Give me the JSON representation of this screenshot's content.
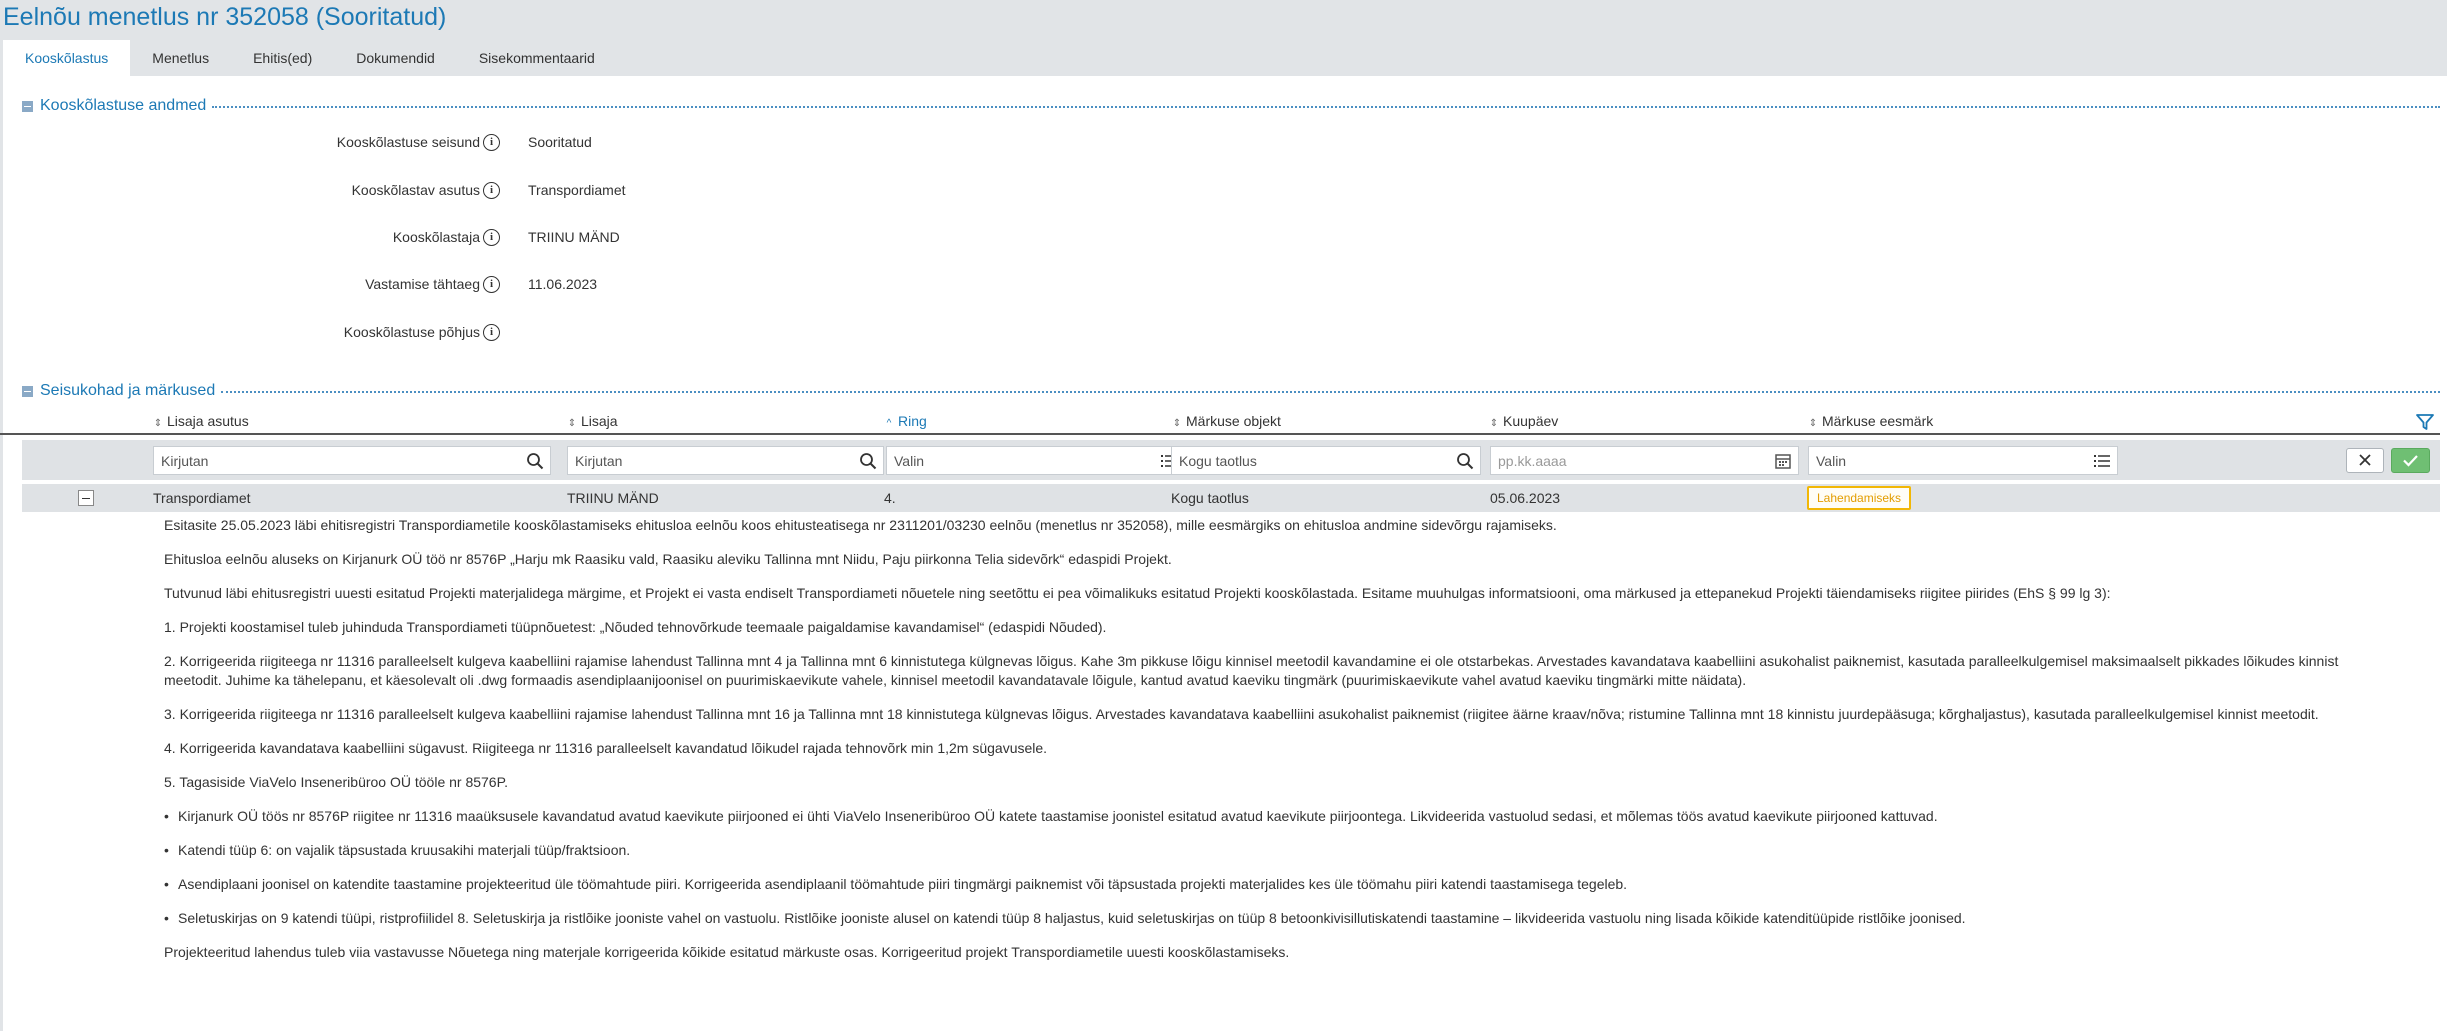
{
  "page": {
    "title": "Eelnõu menetlus nr 352058 (Sooritatud)"
  },
  "tabs": [
    {
      "label": "Kooskõlastus",
      "active": true
    },
    {
      "label": "Menetlus"
    },
    {
      "label": "Ehitis(ed)"
    },
    {
      "label": "Dokumendid"
    },
    {
      "label": "Sisekommentaarid"
    }
  ],
  "section_data": {
    "title": "Kooskõlastuse andmed",
    "fields": [
      {
        "label": "Kooskõlastuse seisund",
        "value": "Sooritatud"
      },
      {
        "label": "Kooskõlastav asutus",
        "value": "Transpordiamet"
      },
      {
        "label": "Kooskõlastaja",
        "value": "TRIINU MÄND"
      },
      {
        "label": "Vastamise tähtaeg",
        "value": "11.06.2023"
      },
      {
        "label": "Kooskõlastuse põhjus",
        "value": ""
      }
    ]
  },
  "section_remarks": {
    "title": "Seisukohad ja märkused",
    "columns": [
      "Lisaja asutus",
      "Lisaja",
      "Ring",
      "Märkuse objekt",
      "Kuupäev",
      "Märkuse eesmärk"
    ],
    "sorted_column": "Ring",
    "filters": {
      "lisaja_asutus": "Kirjutan",
      "lisaja": "Kirjutan",
      "ring": "Valin",
      "markuse_objekt": "Kogu taotlus",
      "kuupaev": "pp.kk.aaaa",
      "markuse_eesmark": "Valin"
    },
    "row": {
      "lisaja_asutus": "Transpordiamet",
      "lisaja": "TRIINU MÄND",
      "ring": "4.",
      "markuse_objekt": "Kogu taotlus",
      "kuupaev": "05.06.2023",
      "markuse_eesmark": "Lahendamiseks"
    },
    "comment": [
      {
        "text": "Esitasite 25.05.2023 läbi ehitisregistri Transpordiametile kooskõlastamiseks ehitusloa eelnõu koos ehitusteatisega nr 2311201/03230 eelnõu (menetlus nr 352058), mille eesmärgiks on ehitusloa andmine sidevõrgu rajamiseks."
      },
      {
        "text": "Ehitusloa eelnõu aluseks on Kirjanurk OÜ töö nr 8576P „Harju mk Raasiku vald, Raasiku aleviku Tallinna mnt Niidu, Paju piirkonna Telia sidevõrk“ edaspidi Projekt."
      },
      {
        "text": "Tutvunud läbi ehitusregistri uuesti esitatud Projekti materjalidega märgime, et Projekt ei vasta endiselt Transpordiameti nõuetele ning seetõttu ei pea võimalikuks esitatud Projekti kooskõlastada. Esitame muuhulgas informatsiooni, oma märkused ja ettepanekud Projekti täiendamiseks riigitee piirides (EhS § 99 lg 3):"
      },
      {
        "text": "1. Projekti koostamisel tuleb juhinduda Transpordiameti tüüpnõuetest: „Nõuded tehnovõrkude teemaale paigaldamise kavandamisel“ (edaspidi Nõuded)."
      },
      {
        "text": "2. Korrigeerida riigiteega nr 11316 paralleelselt kulgeva kaabelliini rajamise lahendust Tallinna mnt 4 ja Tallinna mnt 6 kinnistutega külgnevas lõigus. Kahe 3m pikkuse lõigu kinnisel meetodil kavandamine ei ole otstarbekas. Arvestades kavandatava kaabelliini asukohalist paiknemist, kasutada paralleelkulgemisel maksimaalselt pikkades lõikudes kinnist meetodit. Juhime ka tähelepanu, et käesolevalt oli .dwg formaadis asendiplaanijoonisel on puurimiskaevikute vahele, kinnisel meetodil kavandatavale lõigule, kantud avatud kaeviku tingmärk (puurimiskaevikute vahel avatud kaeviku tingmärki mitte näidata)."
      },
      {
        "text": "3. Korrigeerida riigiteega nr 11316 paralleelselt kulgeva kaabelliini rajamise lahendust Tallinna mnt 16 ja Tallinna mnt 18 kinnistutega külgnevas lõigus. Arvestades kavandatava kaabelliini asukohalist paiknemist (riigitee äärne kraav/nõva; ristumine Tallinna mnt 18 kinnistu juurdepääsuga; kõrghaljastus), kasutada paralleelkulgemisel kinnist meetodit."
      },
      {
        "text": "4. Korrigeerida kavandatava kaabelliini sügavust. Riigiteega nr 11316 paralleelselt kavandatud lõikudel rajada tehnovõrk min 1,2m sügavusele."
      },
      {
        "text": "5. Tagasiside ViaVelo Inseneribüroo OÜ tööle nr 8576P."
      },
      {
        "bullet": "•",
        "text": "Kirjanurk OÜ töös nr 8576P riigitee nr 11316 maaüksusele kavandatud avatud kaevikute piirjooned ei ühti ViaVelo Inseneribüroo OÜ katete taastamise joonistel esitatud avatud kaevikute piirjoontega. Likvideerida vastuolud sedasi, et mõlemas töös avatud kaevikute piirjooned kattuvad."
      },
      {
        "bullet": "•",
        "text": "Katendi tüüp 6: on vajalik täpsustada kruusakihi materjali tüüp/fraktsioon."
      },
      {
        "bullet": "•",
        "text": "Asendiplaani joonisel on katendite taastamine projekteeritud üle töömahtude piiri. Korrigeerida asendiplaanil töömahtude piiri tingmärgi paiknemist või täpsustada projekti materjalides kes üle töömahu piiri  katendi taastamisega tegeleb."
      },
      {
        "bullet": "•",
        "text": "Seletuskirjas on 9 katendi tüüpi, ristprofiilidel 8. Seletuskirja ja ristlõike jooniste vahel on vastuolu. Ristlõike jooniste alusel on katendi tüüp 8 haljastus, kuid seletuskirjas on tüüp 8 betoonkivisillutiskatendi taastamine – likvideerida vastuolu ning lisada kõikide katenditüüpide ristlõike joonised."
      },
      {
        "text": "Projekteeritud lahendus tuleb viia vastavusse Nõuetega ning materjale korrigeerida kõikide esitatud märkuste osas. Korrigeeritud projekt Transpordiametile uuesti kooskõlastamiseks."
      }
    ]
  },
  "icons": {
    "info": "info-circle-icon",
    "search": "search-icon",
    "list": "list-icon",
    "calendar": "calendar-icon",
    "filter": "filter-icon",
    "clear": "close-icon",
    "confirm": "check-icon",
    "sort": "sort-icon",
    "collapse": "minus-icon"
  },
  "colors": {
    "accent": "#1c79b5",
    "header_bg": "#e1e4e7",
    "row_bg": "#dfe2e5",
    "badge_border": "#f2b705",
    "ok_button": "#6fbf73"
  }
}
